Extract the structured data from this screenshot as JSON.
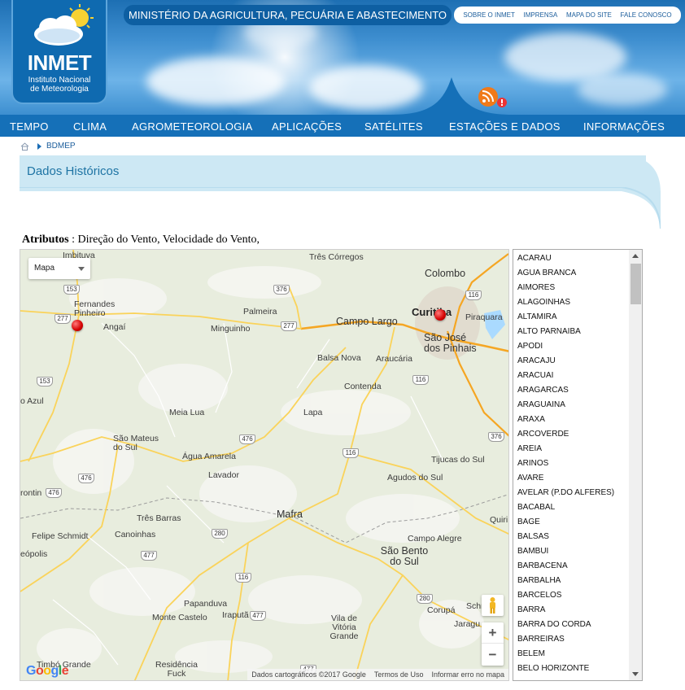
{
  "header": {
    "logo_text": "INMET",
    "logo_subtitle_1": "Instituto Nacional",
    "logo_subtitle_2": "de Meteorologia",
    "ministry": "MINISTÉRIO DA AGRICULTURA, PECUÁRIA E ABASTECIMENTO",
    "top_links": [
      "SOBRE O INMET",
      "IMPRENSA",
      "MAPA DO SITE",
      "FALE CONOSCO"
    ],
    "rss_icon": "rss-icon"
  },
  "nav": {
    "items": [
      "TEMPO",
      "CLIMA",
      "AGROMETEOROLOGIA",
      "APLICAÇÕES",
      "SATÉLITES",
      "ESTAÇÕES E DADOS",
      "INFORMAÇÕES"
    ]
  },
  "breadcrumb": {
    "home_icon": "home-icon",
    "current": "BDMEP"
  },
  "page": {
    "title": "Dados Históricos",
    "attributes_label": "Atributos",
    "attributes_value": ": Direção do Vento, Velocidade do Vento,"
  },
  "map": {
    "type_selector": "Mapa",
    "labels": [
      "Imbituva",
      "Três Córregos",
      "Colombo",
      "Fernandes Pinheiro",
      "Palmeira",
      "Curitiba",
      "Piraquara",
      "Angaí",
      "Minguinho",
      "Campo Largo",
      "São José dos Pinhais",
      "Balsa Nova",
      "Araucária",
      "Contenda",
      "o Azul",
      "Meia Lua",
      "Lapa",
      "São Mateus do Sul",
      "Água Amarela",
      "Tijucas do Sul",
      "Lavador",
      "Agudos do Sul",
      "rontin",
      "Três Barras",
      "Mafra",
      "Quiri",
      "Felipe Schmidt",
      "Canoinhas",
      "Campo Alegre",
      "eópolis",
      "São Bento do Sul",
      "Papanduva",
      "Monte Castelo",
      "Iraputã",
      "Vila de Vitória Grande",
      "Corupá",
      "Schr",
      "Jaragu",
      "Timbó Grande",
      "Residência Fuck"
    ],
    "road_shields": [
      "153",
      "277",
      "376",
      "277",
      "116",
      "153",
      "116",
      "476",
      "376",
      "116",
      "476",
      "476",
      "280",
      "477",
      "116",
      "477",
      "280",
      "477"
    ],
    "zoom_in": "+",
    "zoom_out": "−",
    "attribution": [
      "Dados cartográficos ©2017 Google",
      "Termos de Uso",
      "Informar erro no mapa"
    ],
    "brand": "Google"
  },
  "stations": [
    "ACARAU",
    "AGUA BRANCA",
    "AIMORES",
    "ALAGOINHAS",
    "ALTAMIRA",
    "ALTO PARNAIBA",
    "APODI",
    "ARACAJU",
    "ARACUAI",
    "ARAGARCAS",
    "ARAGUAINA",
    "ARAXA",
    "ARCOVERDE",
    "AREIA",
    "ARINOS",
    "AVARE",
    "AVELAR (P.DO ALFERES)",
    "BACABAL",
    "BAGE",
    "BALSAS",
    "BAMBUI",
    "BARBACENA",
    "BARBALHA",
    "BARCELOS",
    "BARRA",
    "BARRA DO CORDA",
    "BARREIRAS",
    "BELEM",
    "BELO HORIZONTE"
  ],
  "colors": {
    "nav_bg": "#1570b8",
    "title_bg": "#cde8f4",
    "title_text": "#1e74a4",
    "pin": "#d40000"
  }
}
